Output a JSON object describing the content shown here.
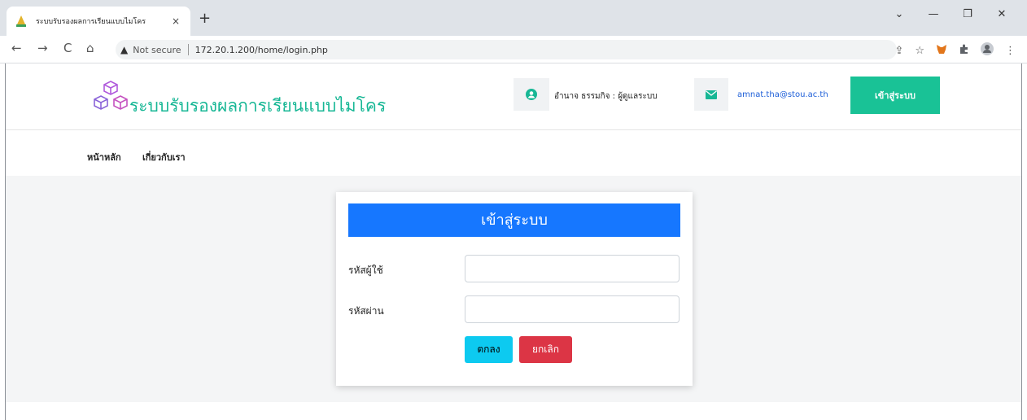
{
  "browser": {
    "tab_title": "ระบบรับรองผลการเรียนแบบไมโคร",
    "tab_close": "×",
    "new_tab": "+",
    "not_secure": "Not secure",
    "url": "172.20.1.200/home/login.php",
    "window_controls": [
      "⌄",
      "—",
      "❐",
      "✕"
    ],
    "back_glyph": "←",
    "forward_glyph": "→",
    "reload_glyph": "C",
    "home_glyph": "⌂",
    "warning_glyph": "▲",
    "share_glyph": "⇪",
    "star_glyph": "☆",
    "menu_glyph": "⋮"
  },
  "header": {
    "site_title": "ระบบรับรองผลการเรียนแบบไมโคร",
    "user_text": "อำนาจ ธรรมกิจ : ผู้ดูแลระบบ",
    "email": "amnat.tha@stou.ac.th",
    "login_button": "เข้าสู่ระบบ"
  },
  "nav": {
    "home": "หน้าหลัก",
    "about": "เกี่ยวกับเรา"
  },
  "login_card": {
    "title": "เข้าสู่ระบบ",
    "username_label": "รหัสผู้ใช้",
    "password_label": "รหัสผ่าน",
    "username_value": "",
    "password_value": "",
    "ok_button": "ตกลง",
    "cancel_button": "ยกเลิก"
  },
  "colors": {
    "accent_green": "#19c296",
    "title_green": "#17b795",
    "header_blue": "#1677ff",
    "ok_cyan": "#0dcaf0",
    "cancel_red": "#dc3545"
  }
}
